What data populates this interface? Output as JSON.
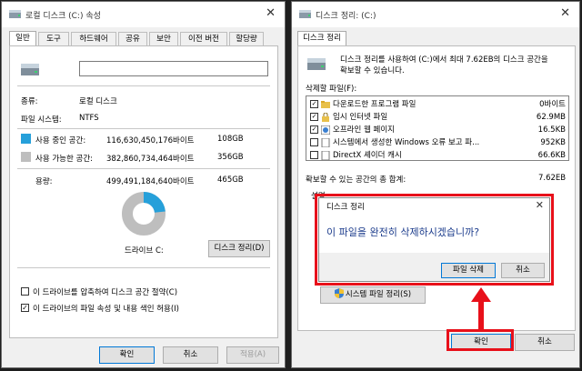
{
  "left_window": {
    "title": "로컬 디스크 (C:) 속성",
    "tabs": [
      "일반",
      "도구",
      "하드웨어",
      "공유",
      "보안",
      "이전 버전",
      "할당량"
    ],
    "name_value": "",
    "type_label": "종류:",
    "type_value": "로컬 디스크",
    "fs_label": "파일 시스템:",
    "fs_value": "NTFS",
    "used_label": "사용 중인 공간:",
    "used_bytes": "116,630,450,176바이트",
    "used_gb": "108GB",
    "free_label": "사용 가능한 공간:",
    "free_bytes": "382,860,734,464바이트",
    "free_gb": "356GB",
    "cap_label": "용량:",
    "cap_bytes": "499,491,184,640바이트",
    "cap_gb": "465GB",
    "used_fraction": 0.233,
    "drive_label": "드라이브 C:",
    "cleanup_button": "디스크 정리(D)",
    "compress_label": "이 드라이브를 압축하여 디스크 공간 절약(C)",
    "compress_checked": false,
    "index_label": "이 드라이브의 파일 속성 및 내용 색인 허용(I)",
    "index_checked": true,
    "ok_button": "확인",
    "cancel_button": "취소",
    "apply_button": "적용(A)",
    "colors": {
      "used": "#26a0da",
      "free": "#bebebe"
    }
  },
  "right_window": {
    "title": "디스크 정리: (C:)",
    "tab": "디스크 정리",
    "description_line1": "디스크 정리를 사용하여 (C:)에서 최대 7.62EB의 디스크 공간을",
    "description_line2": "확보할 수 있습니다.",
    "files_label": "삭제할 파일(F):",
    "files": [
      {
        "name": "다운로드한 프로그램 파일",
        "size": "0바이트",
        "checked": true,
        "icon": "folder-icon"
      },
      {
        "name": "임시 인터넷 파일",
        "size": "62.9MB",
        "checked": true,
        "icon": "lock-icon"
      },
      {
        "name": "오프라인 웹 페이지",
        "size": "16.5KB",
        "checked": true,
        "icon": "web-page-icon"
      },
      {
        "name": "시스템에서 생성한 Windows 오류 보고 파...",
        "size": "952KB",
        "checked": false,
        "icon": "document-icon"
      },
      {
        "name": "DirectX 셰이더 캐시",
        "size": "66.6KB",
        "checked": false,
        "icon": "document-icon"
      }
    ],
    "total_label": "확보할 수 있는 공간의 총 합계:",
    "total_value": "7.62EB",
    "description_cut": "설명",
    "system_cleanup_button": "시스템 파일 정리(S)",
    "ok_button": "확인",
    "cancel_button": "취소"
  },
  "dialog": {
    "title": "디스크 정리",
    "message": "이 파일을 완전히 삭제하시겠습니까?",
    "delete_button": "파일 삭제",
    "cancel_button": "취소"
  },
  "highlight_color": "#e8101a"
}
